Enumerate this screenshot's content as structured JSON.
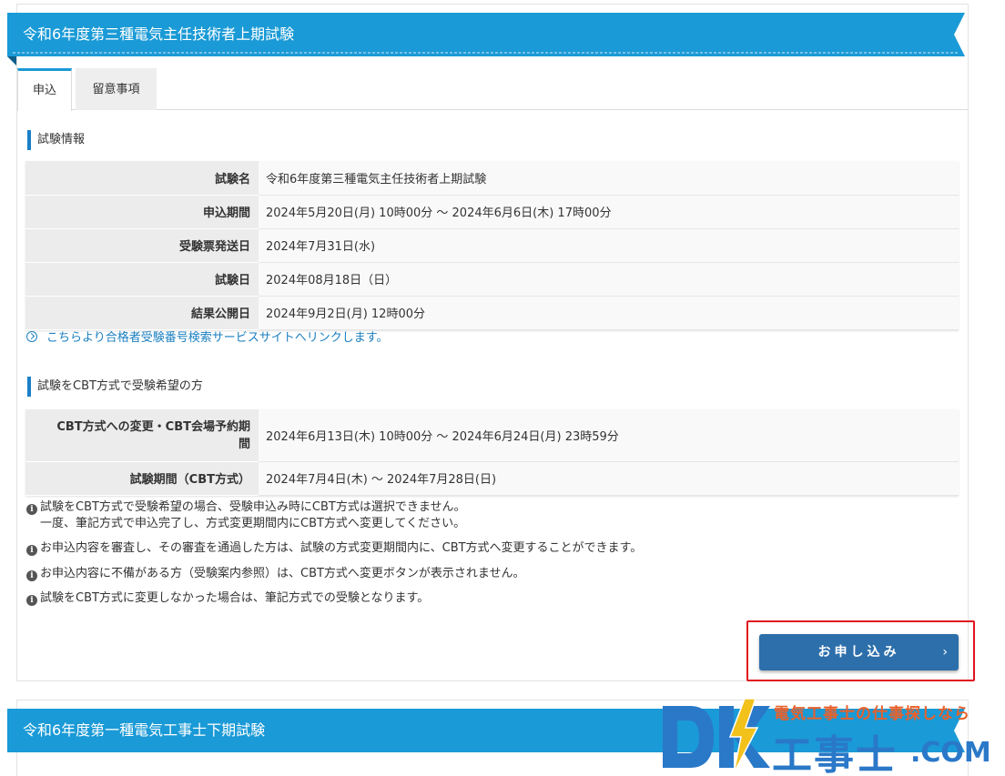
{
  "exam": {
    "title": "令和6年度第三種電気主任技術者上期試験"
  },
  "tabs": [
    {
      "label": "申込",
      "active": true
    },
    {
      "label": "留意事項",
      "active": false
    }
  ],
  "exam_info": {
    "heading": "試験情報",
    "rows": [
      {
        "label": "試験名",
        "value": "令和6年度第三種電気主任技術者上期試験"
      },
      {
        "label": "申込期間",
        "value": "2024年5月20日(月) 10時00分 ～ 2024年6月6日(木) 17時00分"
      },
      {
        "label": "受験票発送日",
        "value": "2024年7月31日(水)"
      },
      {
        "label": "試験日",
        "value": "2024年08月18日（日）"
      },
      {
        "label": "結果公開日",
        "value": "2024年9月2日(月) 12時00分"
      }
    ],
    "link_text": "こちらより合格者受験番号検索サービスサイトへリンクします。"
  },
  "cbt_info": {
    "heading": "試験をCBT方式で受験希望の方",
    "rows": [
      {
        "label_line1": "CBT方式への変更・CBT会場予約期",
        "label_line2": "間",
        "value": "2024年6月13日(木) 10時00分 ～ 2024年6月24日(月) 23時59分"
      },
      {
        "label": "試験期間（CBT方式）",
        "value": "2024年7月4日(木) ～ 2024年7月28日(日)"
      }
    ],
    "notes": [
      {
        "line1": "試験をCBT方式で受験希望の場合、受験申込み時にCBT方式は選択できません。",
        "line2": "一度、筆記方式で申込完了し、方式変更期間内にCBT方式へ変更してください。"
      },
      {
        "line1": "お申込内容を審査し、その審査を通過した方は、試験の方式変更期間内に、CBT方式へ変更することができます。"
      },
      {
        "line1": "お申込内容に不備がある方（受験案内参照）は、CBT方式へ変更ボタンが表示されません。"
      },
      {
        "line1": "試験をCBT方式に変更しなかった場合は、筆記方式での受験となります。"
      }
    ]
  },
  "apply_button": {
    "label": "お申し込み",
    "chevron": "›"
  },
  "next_exam": {
    "title": "令和6年度第一種電気工事士下期試験"
  },
  "watermark": {
    "tagline": "電気工事士の仕事探しなら",
    "kanji": "工事士",
    "com": ".COM",
    "logo_letters": "DK"
  },
  "colors": {
    "ribbon": "#1a9ad6",
    "ribbon_fold": "#0d5f88",
    "accent_bar": "#1a80c8",
    "link": "#1a7fc0",
    "button": "#2d6fab",
    "highlight": "#e0141e",
    "watermark_blue": "#2a78c8",
    "watermark_orange": "#e8612c",
    "watermark_yellow": "#f2c11a"
  }
}
